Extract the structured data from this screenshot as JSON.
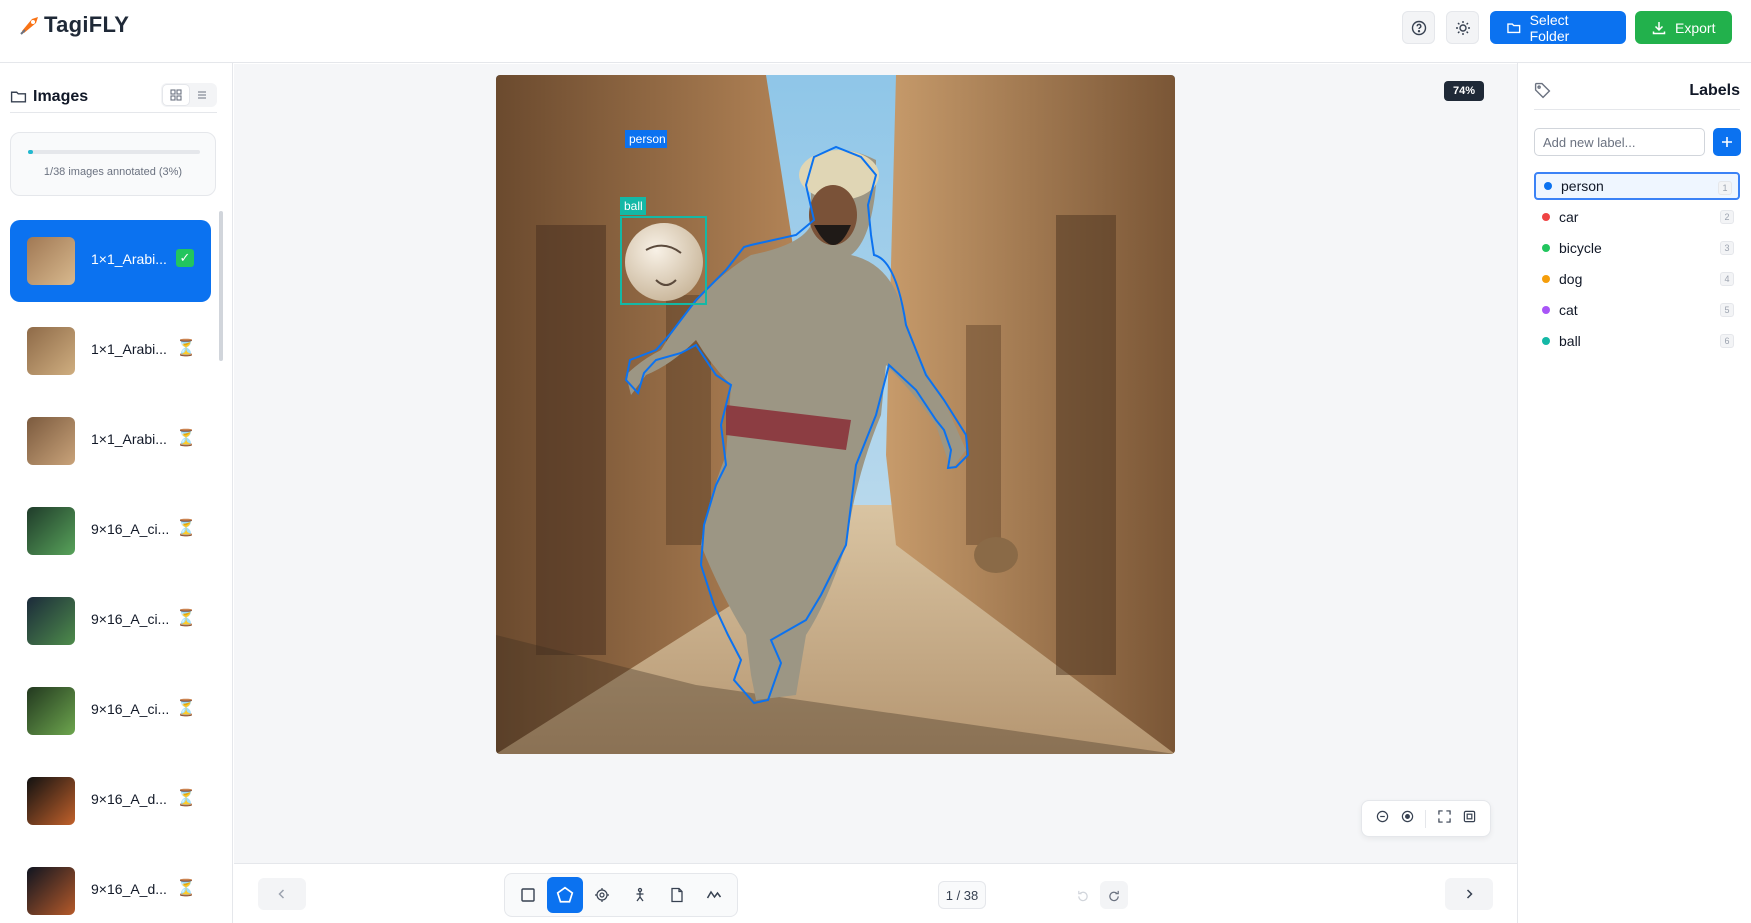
{
  "app": {
    "name": "TagiFLY"
  },
  "header": {
    "select_folder_label": "Select Folder",
    "export_label": "Export",
    "colors": {
      "primary": "#0b72f0",
      "export": "#22b14c"
    }
  },
  "sidebar": {
    "title": "Images",
    "progress": {
      "text": "1/38 images annotated (3%)",
      "fraction": 0.03
    },
    "images": [
      {
        "name": "1×1_Arabi...",
        "status": "done",
        "status_glyph": "✓",
        "active": true
      },
      {
        "name": "1×1_Arabi...",
        "status": "pending",
        "status_glyph": "⏳"
      },
      {
        "name": "1×1_Arabi...",
        "status": "pending",
        "status_glyph": "⏳"
      },
      {
        "name": "9×16_A_ci...",
        "status": "pending",
        "status_glyph": "⏳"
      },
      {
        "name": "9×16_A_ci...",
        "status": "pending",
        "status_glyph": "⏳"
      },
      {
        "name": "9×16_A_ci...",
        "status": "pending",
        "status_glyph": "⏳"
      },
      {
        "name": "9×16_A_d...",
        "status": "pending",
        "status_glyph": "⏳"
      },
      {
        "name": "9×16_A_d...",
        "status": "pending",
        "status_glyph": "⏳"
      }
    ]
  },
  "canvas": {
    "zoom": "74%",
    "annotations": [
      {
        "label": "person",
        "type": "polygon",
        "color": "#0b72f0"
      },
      {
        "label": "ball",
        "type": "rectangle",
        "color": "#14b8a6"
      }
    ]
  },
  "bottom": {
    "page_indicator": "1 / 38",
    "tools": [
      "rectangle-tool",
      "polygon-tool",
      "point-tool",
      "keypoint-tool",
      "mask-tool",
      "polyline-tool"
    ],
    "active_tool": "polygon-tool"
  },
  "labels_panel": {
    "title": "Labels",
    "input_placeholder": "Add new label...",
    "labels": [
      {
        "name": "person",
        "key": "1",
        "color": "#0b72f0",
        "selected": true
      },
      {
        "name": "car",
        "key": "2",
        "color": "#ef4444"
      },
      {
        "name": "bicycle",
        "key": "3",
        "color": "#22c55e"
      },
      {
        "name": "dog",
        "key": "4",
        "color": "#f59e0b"
      },
      {
        "name": "cat",
        "key": "5",
        "color": "#a855f7"
      },
      {
        "name": "ball",
        "key": "6",
        "color": "#14b8a6"
      }
    ]
  }
}
